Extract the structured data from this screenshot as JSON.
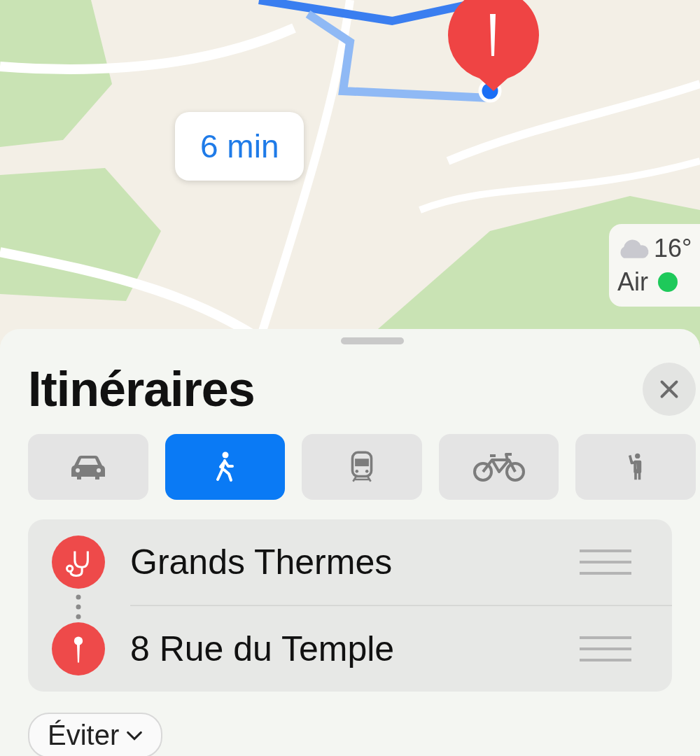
{
  "map": {
    "route_time": "6 min",
    "weather": {
      "temperature": "16°",
      "air": {
        "label": "Air",
        "color": "#1ec95a"
      }
    }
  },
  "sheet": {
    "title": "Itinéraires",
    "modes": [
      {
        "kind": "car",
        "selected": false
      },
      {
        "kind": "walk",
        "selected": true
      },
      {
        "kind": "transit",
        "selected": false
      },
      {
        "kind": "bike",
        "selected": false
      },
      {
        "kind": "hail",
        "selected": false
      }
    ],
    "stops": [
      {
        "kind": "health",
        "name": "Grands Thermes"
      },
      {
        "kind": "pin",
        "name": "8 Rue du Temple"
      }
    ],
    "avoid_button": "Éviter"
  }
}
